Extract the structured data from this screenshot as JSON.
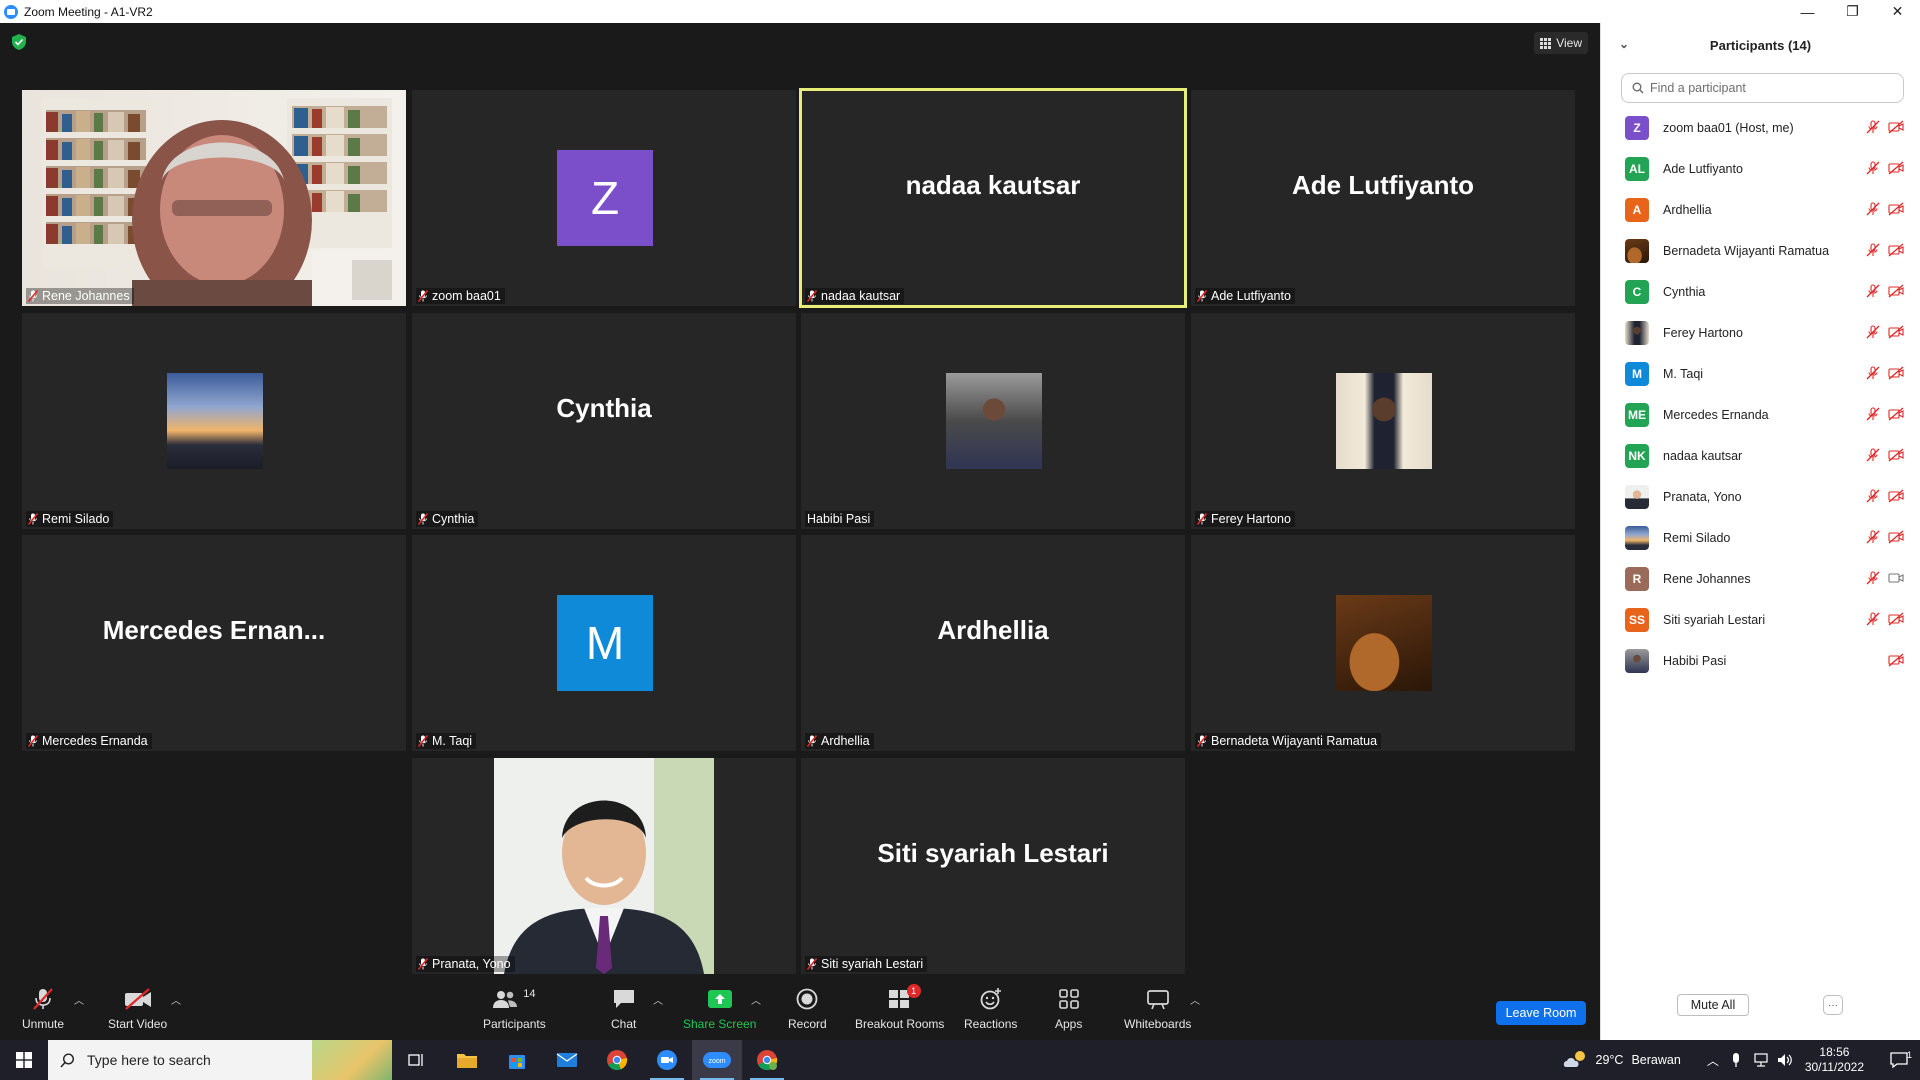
{
  "window": {
    "title": "Zoom Meeting - A1-VR2",
    "minimize": "—",
    "restore": "❐",
    "close": "✕"
  },
  "meeting": {
    "view_label": "View",
    "tiles": [
      {
        "label": "Rene Johannes",
        "display": "photo-room",
        "muted": true
      },
      {
        "label": "zoom baa01",
        "display": "avatar",
        "initial": "Z",
        "color": "#7b4fc9",
        "muted": true
      },
      {
        "label": "nadaa kautsar",
        "display": "name",
        "big": "nadaa kautsar",
        "muted": true,
        "active": true
      },
      {
        "label": "Ade Lutfiyanto",
        "display": "name",
        "big": "Ade Lutfiyanto",
        "muted": true
      },
      {
        "label": "Remi Silado",
        "display": "photo-sunset",
        "muted": true
      },
      {
        "label": "Cynthia",
        "display": "name",
        "big": "Cynthia",
        "muted": true
      },
      {
        "label": "Habibi Pasi",
        "display": "photo-man-dark",
        "muted": false
      },
      {
        "label": "Ferey Hartono",
        "display": "photo-man-suit",
        "muted": true
      },
      {
        "label": "Mercedes Ernanda",
        "display": "name",
        "big": "Mercedes  Ernan...",
        "muted": true
      },
      {
        "label": "M. Taqi",
        "display": "avatar",
        "initial": "M",
        "color": "#0e8ad9",
        "muted": true
      },
      {
        "label": "Ardhellia",
        "display": "name",
        "big": "Ardhellia",
        "muted": true
      },
      {
        "label": "Bernadeta Wijayanti Ramatua",
        "display": "photo-guitar",
        "muted": true
      },
      {
        "label": "Pranata, Yono",
        "display": "photo-portrait",
        "muted": true
      },
      {
        "label": "Siti syariah Lestari",
        "display": "name",
        "big": "Siti syariah Lestari",
        "muted": true
      }
    ]
  },
  "toolbar": {
    "unmute": "Unmute",
    "start_video": "Start Video",
    "participants": "Participants",
    "participants_count": "14",
    "chat": "Chat",
    "share_screen": "Share Screen",
    "record": "Record",
    "breakout_rooms": "Breakout Rooms",
    "breakout_badge": "1",
    "reactions": "Reactions",
    "apps": "Apps",
    "whiteboards": "Whiteboards",
    "leave_room": "Leave Room"
  },
  "panel": {
    "title": "Participants (14)",
    "search_placeholder": "Find a participant",
    "mute_all": "Mute All",
    "more": "···",
    "participants": [
      {
        "name": "zoom baa01 (Host, me)",
        "initials": "Z",
        "color": "#7b4fc9",
        "mic": true,
        "video": "off"
      },
      {
        "name": "Ade Lutfiyanto",
        "initials": "AL",
        "color": "#23a455",
        "mic": true,
        "video": "off"
      },
      {
        "name": "Ardhellia",
        "initials": "A",
        "color": "#e8641b",
        "mic": true,
        "video": "off"
      },
      {
        "name": "Bernadeta Wijayanti Ramatua",
        "initials": "",
        "photo": "guitar",
        "color": "#8a5a2b",
        "mic": true,
        "video": "off"
      },
      {
        "name": "Cynthia",
        "initials": "C",
        "color": "#23a455",
        "mic": true,
        "video": "off"
      },
      {
        "name": "Ferey Hartono",
        "initials": "",
        "photo": "suit",
        "color": "#c9bca8",
        "mic": true,
        "video": "off"
      },
      {
        "name": "M. Taqi",
        "initials": "M",
        "color": "#0e8ad9",
        "mic": true,
        "video": "off"
      },
      {
        "name": "Mercedes Ernanda",
        "initials": "ME",
        "color": "#23a455",
        "mic": true,
        "video": "off"
      },
      {
        "name": "nadaa kautsar",
        "initials": "NK",
        "color": "#23a455",
        "mic": true,
        "video": "off"
      },
      {
        "name": "Pranata, Yono",
        "initials": "",
        "photo": "portrait",
        "color": "#d8d8d8",
        "mic": true,
        "video": "off"
      },
      {
        "name": "Remi Silado",
        "initials": "",
        "photo": "sunset",
        "color": "#6d86b8",
        "mic": true,
        "video": "off"
      },
      {
        "name": "Rene Johannes",
        "initials": "R",
        "color": "#9a6a5a",
        "mic": true,
        "video": "on"
      },
      {
        "name": "Siti syariah Lestari",
        "initials": "SS",
        "color": "#e8641b",
        "mic": true,
        "video": "off"
      },
      {
        "name": "Habibi Pasi",
        "initials": "",
        "photo": "dark",
        "color": "#3a3a3a",
        "mic": false,
        "video": "off"
      }
    ]
  },
  "taskbar": {
    "search_placeholder": "Type here to search",
    "weather_temp": "29°C",
    "weather_desc": "Berawan",
    "time": "18:56",
    "date": "30/11/2022",
    "notification_count": "1"
  },
  "colors": {
    "accent_blue": "#0e71eb",
    "active_speaker": "#e7ee78",
    "muted_red": "#e02828",
    "share_green": "#1ec753"
  }
}
